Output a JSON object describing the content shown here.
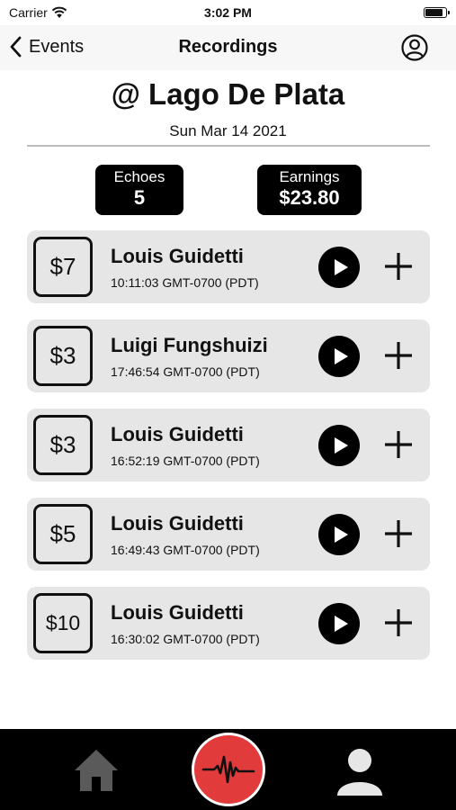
{
  "status_bar": {
    "carrier": "Carrier",
    "time": "3:02 PM"
  },
  "nav": {
    "back_label": "Events",
    "title": "Recordings"
  },
  "event": {
    "venue": "@ Lago De Plata",
    "date": "Sun Mar 14 2021"
  },
  "stats": {
    "echoes_label": "Echoes",
    "echoes_value": "5",
    "earnings_label": "Earnings",
    "earnings_value": "$23.80"
  },
  "recordings": [
    {
      "amount": "$7",
      "name": "Louis Guidetti",
      "time": "10:11:03 GMT-0700 (PDT)"
    },
    {
      "amount": "$3",
      "name": "Luigi Fungshuizi",
      "time": "17:46:54 GMT-0700 (PDT)"
    },
    {
      "amount": "$3",
      "name": "Louis Guidetti",
      "time": "16:52:19 GMT-0700 (PDT)"
    },
    {
      "amount": "$5",
      "name": "Louis Guidetti",
      "time": "16:49:43 GMT-0700 (PDT)"
    },
    {
      "amount": "$10",
      "name": "Louis Guidetti",
      "time": "16:30:02 GMT-0700 (PDT)"
    }
  ],
  "icons": {
    "wifi": "wifi-icon",
    "battery": "battery-icon",
    "back": "chevron-left-icon",
    "profile": "user-circle-icon",
    "play": "play-icon",
    "add": "plus-icon",
    "home": "home-icon",
    "record": "waveform-icon",
    "account": "user-icon"
  },
  "colors": {
    "record_button": "#e23b3b",
    "card_background": "#e6e6e6",
    "tab_bar": "#000000"
  }
}
